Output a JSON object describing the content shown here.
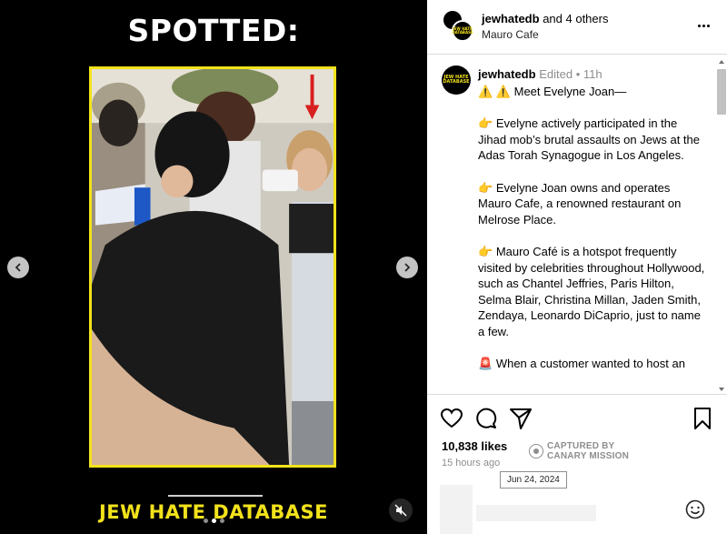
{
  "media": {
    "overlay_title": "SPOTTED:",
    "brand_text": "JEW HATE DATABASE",
    "slide_count": 3,
    "active_slide": 2,
    "accent_color": "#f2e21b",
    "background_color": "#000000",
    "icons": {
      "prev": "chevron-left-icon",
      "next": "chevron-right-icon",
      "mute": "speaker-muted-icon",
      "annotation": "red-arrow-down-icon"
    }
  },
  "header": {
    "username": "jewhatedb",
    "collaborators_text": " and 4 others",
    "location": "Mauro Cafe",
    "avatar_text": "JEW HATE DATABASE",
    "more_icon": "more-horizontal-icon"
  },
  "caption": {
    "username": "jewhatedb",
    "edited_label": "Edited",
    "separator": " •",
    "age": "11h",
    "avatar_text": "JEW HATE DATABASE",
    "intro_emoji": "⚠️ ⚠️",
    "intro_text": "Meet Evelyne Joan—",
    "bullet_emoji": "👉",
    "paragraphs": [
      "Evelyne actively participated in the Jihad mob’s brutal assaults on Jews at the Adas Torah Synagogue in Los Angeles.",
      "Evelyne Joan owns and operates Mauro Cafe, a renowned restaurant on Melrose Place.",
      "Mauro Café is a hotspot frequently visited by celebrities throughout Hollywood, such as Chantel Jeffries, Paris Hilton, Selma Blair, Christina Millan, Jaden Smith, Zendaya, Leonardo DiCaprio, just to name a few."
    ],
    "last_emoji": "🚨",
    "last_text_visible": "When a customer wanted to host an"
  },
  "actions": {
    "like_icon": "heart-icon",
    "comment_icon": "comment-icon",
    "share_icon": "send-icon",
    "save_icon": "bookmark-icon",
    "likes_text": "10,838 likes",
    "time_ago": "15 hours ago",
    "captured_line1": "CAPTURED BY",
    "captured_line2": "CANARY MISSION",
    "captured_logo": "canary-mission-logo",
    "tooltip_date": "Jun 24, 2024"
  },
  "comment": {
    "emoji_icon": "smiley-icon"
  }
}
